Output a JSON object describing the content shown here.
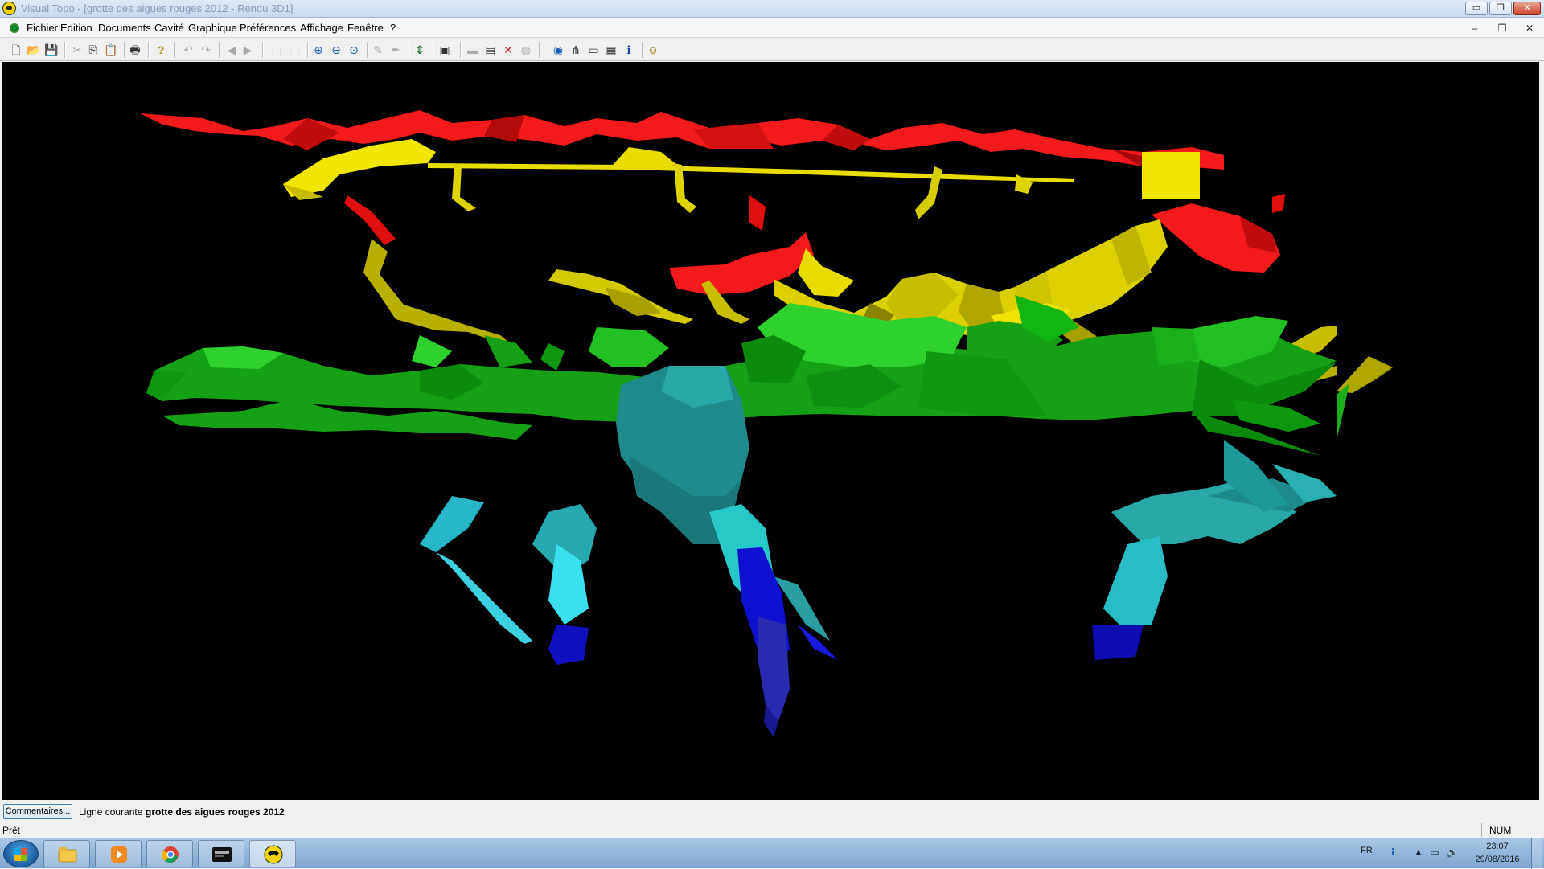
{
  "window": {
    "title": "Visual Topo - [grotte des aigues rouges 2012 - Rendu 3D1]",
    "controls": {
      "minimize": "▭",
      "restore": "❐",
      "close": "✕"
    },
    "mdi_controls": {
      "minimize": "–",
      "restore": "❐",
      "close": "✕"
    }
  },
  "menu": {
    "items": [
      "Fichier",
      "Edition",
      "Documents",
      "Cavité",
      "Graphique",
      "Préférences",
      "Affichage",
      "Fenêtre",
      "?"
    ]
  },
  "toolbar": {
    "buttons": [
      {
        "icon": "new-document-icon",
        "glyph": "🗋"
      },
      {
        "icon": "open-folder-icon",
        "glyph": "📂"
      },
      {
        "icon": "save-icon",
        "glyph": "💾"
      },
      {
        "icon": "cut-icon",
        "glyph": "✂"
      },
      {
        "icon": "copy-icon",
        "glyph": "⎘"
      },
      {
        "icon": "paste-icon",
        "glyph": "📋"
      },
      {
        "icon": "print-icon",
        "glyph": "🖶"
      },
      {
        "icon": "help-icon",
        "glyph": "?"
      },
      {
        "icon": "undo-icon",
        "glyph": "↶"
      },
      {
        "icon": "redo-icon",
        "glyph": "↷"
      },
      {
        "icon": "back-icon",
        "glyph": "◀"
      },
      {
        "icon": "forward-icon",
        "glyph": "▶"
      },
      {
        "icon": "select-icon",
        "glyph": "⬚"
      },
      {
        "icon": "select-area-icon",
        "glyph": "⬚"
      },
      {
        "icon": "zoom-in-icon",
        "glyph": "⊕"
      },
      {
        "icon": "zoom-out-icon",
        "glyph": "⊖"
      },
      {
        "icon": "zoom-fit-icon",
        "glyph": "⊙"
      },
      {
        "icon": "pencil-icon",
        "glyph": "✎"
      },
      {
        "icon": "pen-icon",
        "glyph": "✒"
      },
      {
        "icon": "vertical-arrows-icon",
        "glyph": "⇕"
      },
      {
        "icon": "render-3d-icon",
        "glyph": "▣"
      },
      {
        "icon": "section-icon",
        "glyph": "▬"
      },
      {
        "icon": "export-icon",
        "glyph": "▤"
      },
      {
        "icon": "cross-icon",
        "glyph": "✕"
      },
      {
        "icon": "sphere-icon",
        "glyph": "◍"
      },
      {
        "icon": "globe-icon",
        "glyph": "◉"
      },
      {
        "icon": "network-icon",
        "glyph": "⋔"
      },
      {
        "icon": "monitor-icon",
        "glyph": "▭"
      },
      {
        "icon": "grid-icon",
        "glyph": "▦"
      },
      {
        "icon": "info-icon",
        "glyph": "ℹ"
      },
      {
        "icon": "about-icon",
        "glyph": "☺"
      }
    ]
  },
  "view": {
    "legend_colors": [
      "#ff1a1a",
      "#f2f200",
      "#2ecc40",
      "#2aa8a8",
      "#1010ff"
    ]
  },
  "comment_bar": {
    "button_label": "Commentaires...",
    "current_line_label": "Ligne courante :",
    "current_line_value": "grotte des aigues rouges 2012"
  },
  "status_bar": {
    "status": "Prêt",
    "num": "NUM"
  },
  "taskbar": {
    "apps": [
      {
        "name": "explorer-icon"
      },
      {
        "name": "media-player-icon"
      },
      {
        "name": "chrome-icon"
      },
      {
        "name": "gopro-icon"
      },
      {
        "name": "visual-topo-icon"
      }
    ],
    "tray": {
      "language": "FR",
      "time": "23:07",
      "date": "29/08/2016"
    }
  }
}
